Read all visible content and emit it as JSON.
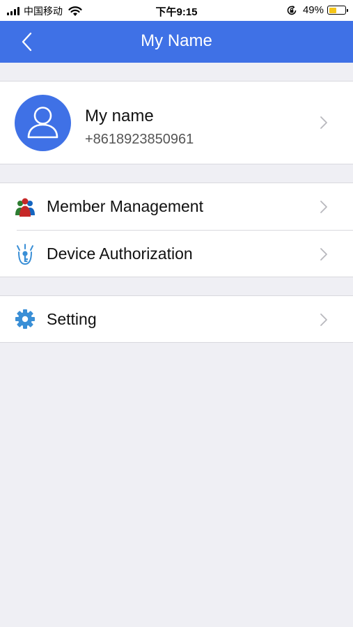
{
  "status_bar": {
    "carrier": "中国移动",
    "time": "下午9:15",
    "battery": "49%",
    "battery_level": 0.49,
    "icons": [
      "signal-icon",
      "wifi-icon",
      "rotation-lock-icon",
      "battery-icon"
    ]
  },
  "nav": {
    "title": "My Name",
    "back_icon": "chevron-left-icon"
  },
  "profile": {
    "name": "My name",
    "phone": "+8618923850961",
    "avatar_icon": "user-avatar-icon"
  },
  "menu": {
    "member_management": {
      "label": "Member Management",
      "icon": "members-icon"
    },
    "device_authorization": {
      "label": "Device Authorization",
      "icon": "key-authorization-icon"
    },
    "setting": {
      "label": "Setting",
      "icon": "gear-icon"
    }
  },
  "colors": {
    "primary": "#3f71e6",
    "background": "#efeff4",
    "card": "#ffffff",
    "chevron": "#b8b8bd",
    "battery_fill": "#f5c518"
  }
}
